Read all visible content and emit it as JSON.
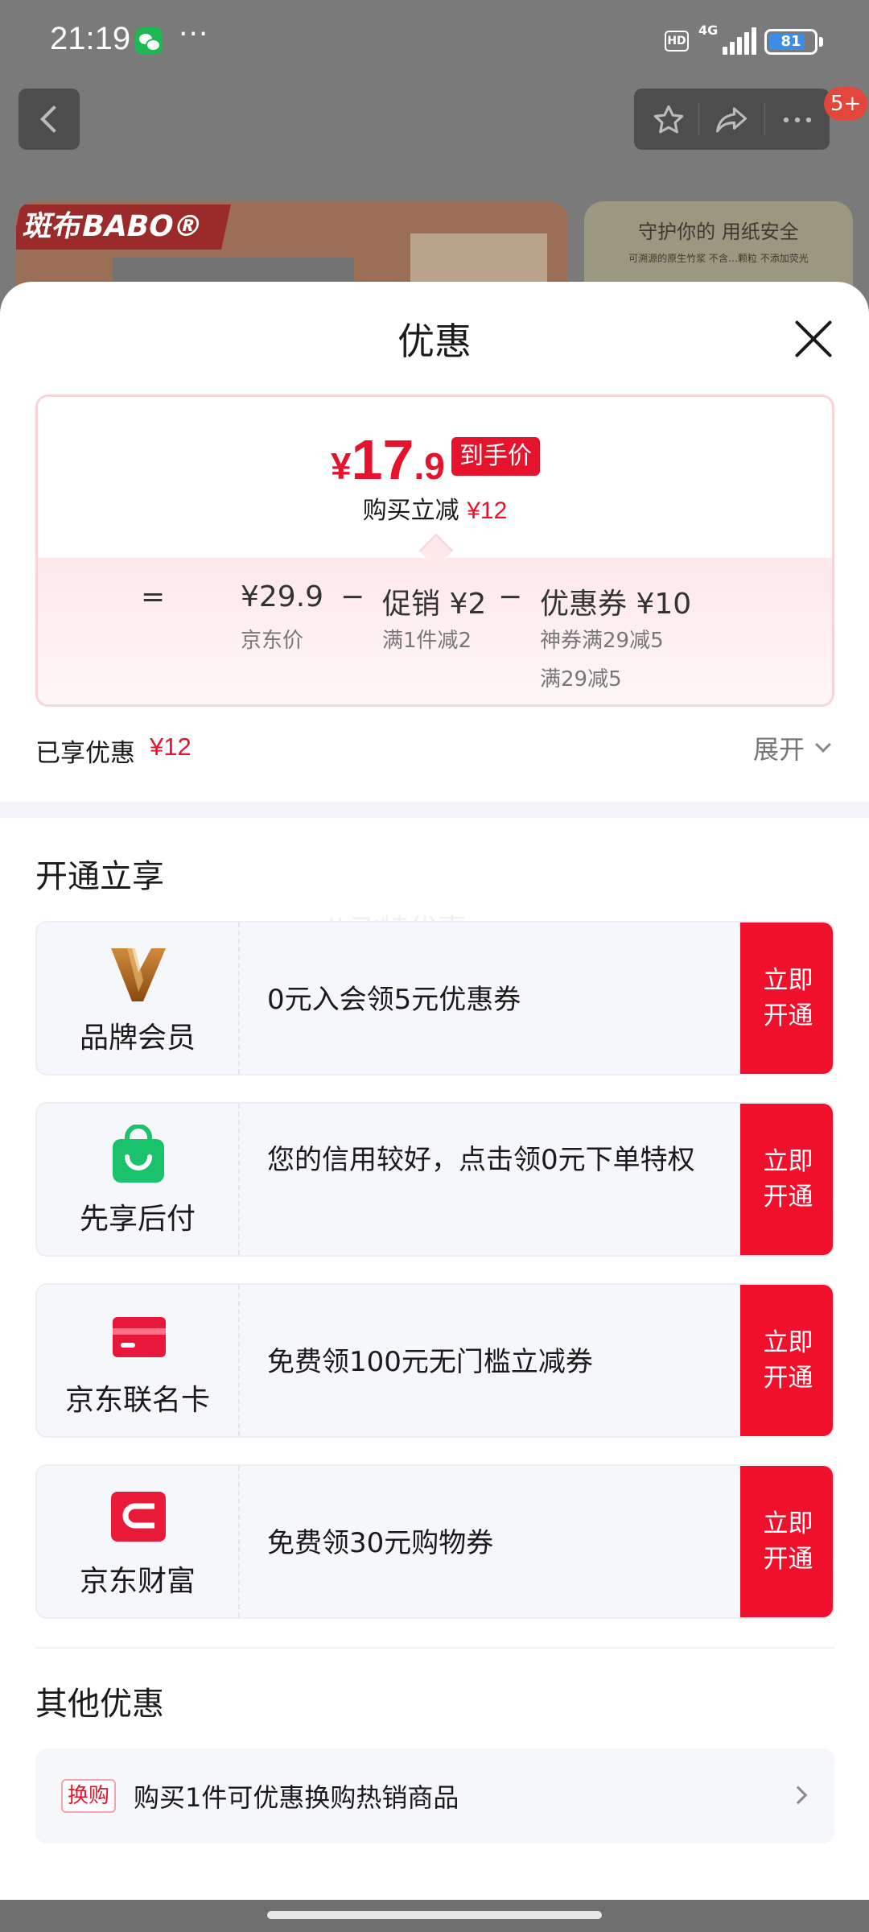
{
  "status_bar": {
    "time": "21:19",
    "more": "···",
    "hd": "HD",
    "network": "4G",
    "battery": "81",
    "battery_level": 0.81
  },
  "top_nav": {
    "icons": [
      "back-icon",
      "star-icon",
      "share-icon",
      "more-icon"
    ],
    "notification_count": "5+"
  },
  "background_page": {
    "brand": "斑布BABO®",
    "banner_right_title": "守护你的 用纸安全",
    "banner_right_sub": "可溯源的原生竹浆   不含…颗粒   不添加荧光"
  },
  "sheet": {
    "title": "优惠",
    "price": {
      "currency": "¥",
      "integer": "17",
      "decimal": ".9",
      "tag": "到手价",
      "saved_prefix": "购买立减",
      "saved_value": "¥12"
    },
    "breakdown": {
      "equals": "=",
      "minus": "−",
      "items": [
        {
          "main": "¥29.9",
          "sub": [
            "京东价"
          ]
        },
        {
          "main": "促销 ¥2",
          "sub": [
            "满1件减2"
          ]
        },
        {
          "main": "优惠券 ¥10",
          "sub": [
            "神券满29减5",
            "满29减5"
          ]
        }
      ]
    },
    "enjoyed_label": "已享优惠",
    "enjoyed_value": "¥12",
    "expand_label": "展开",
    "open_section": {
      "title": "开通立享",
      "watermark": "八飞特优惠",
      "offers": [
        {
          "name": "品牌会员",
          "icon": "brand-v-icon",
          "desc": "0元入会领5元优惠券",
          "button": "立即开通"
        },
        {
          "name": "先享后付",
          "icon": "shopping-bag-icon",
          "desc": "您的信用较好，点击领0元下单特权",
          "button": "立即开通"
        },
        {
          "name": "京东联名卡",
          "icon": "credit-card-icon",
          "desc": "免费领100元无门槛立减券",
          "button": "立即开通"
        },
        {
          "name": "京东财富",
          "icon": "jd-finance-icon",
          "desc": "免费领30元购物券",
          "button": "立即开通"
        }
      ]
    },
    "other_section": {
      "title": "其他优惠",
      "tag": "换购",
      "text": "购买1件可优惠换购热销商品"
    }
  },
  "colors": {
    "accent_red": "#e6132d",
    "button_red": "#f0102c",
    "brand_v_gold": "#a0601a",
    "bag_green": "#19c26b"
  }
}
